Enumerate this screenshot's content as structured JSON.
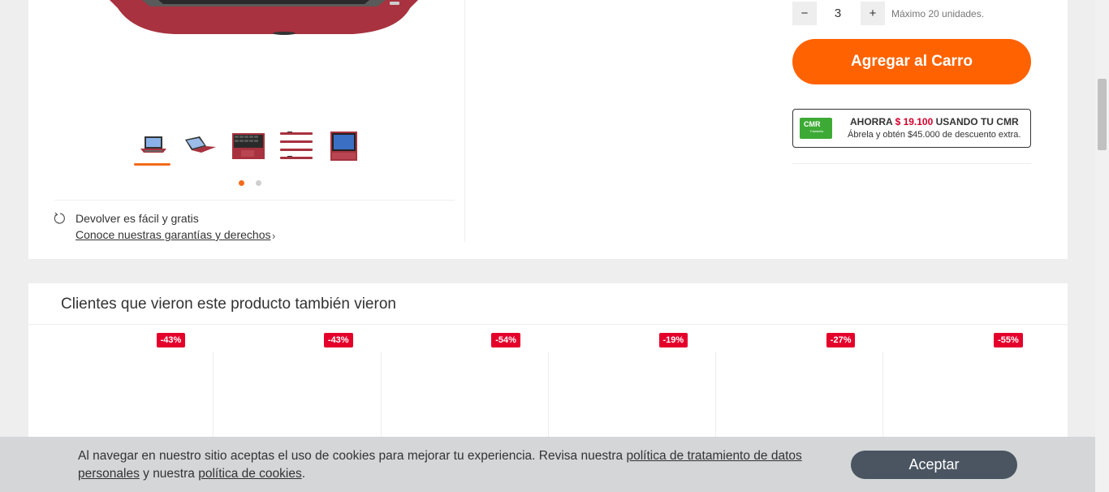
{
  "gallery": {
    "thumbnails": [
      {
        "icon": "laptop-open-front"
      },
      {
        "icon": "laptop-open-side"
      },
      {
        "icon": "laptop-keyboard-closeup"
      },
      {
        "icon": "laptop-closed-stack"
      },
      {
        "icon": "laptop-screen-front"
      }
    ],
    "return_text": "Devolver es fácil y gratis",
    "return_link": "Conoce nuestras garantías y derechos",
    "return_chevron": "›"
  },
  "purchase": {
    "qty_minus": "−",
    "qty_value": "3",
    "qty_plus": "+",
    "qty_max": "Máximo 20 unidades.",
    "add_to_cart": "Agregar al Carro",
    "cmr_logo": "CMR",
    "cmr_logo_sub": "Falabella",
    "cmr_prefix": "AHORRA",
    "cmr_amount": "$ 19.100",
    "cmr_suffix": "USANDO TU CMR",
    "cmr_detail": "Ábrela y obtén $45.000 de descuento extra."
  },
  "recommendations": {
    "title": "Clientes que vieron este producto también vieron",
    "discounts": [
      "-43%",
      "-43%",
      "-54%",
      "-19%",
      "-27%",
      "-55%"
    ]
  },
  "cookies": {
    "text_1": "Al navegar en nuestro sitio aceptas el uso de cookies para mejorar tu experiencia. Revisa nuestra ",
    "link_privacy": "política de tratamiento de datos personales",
    "text_2": " y nuestra ",
    "link_cookies": "política de cookies",
    "text_3": ".",
    "accept": "Aceptar"
  },
  "colors": {
    "accent": "#ff6200",
    "discount": "#e4002b",
    "cmr_green": "#3daa35",
    "accept_button": "#4a5561"
  }
}
